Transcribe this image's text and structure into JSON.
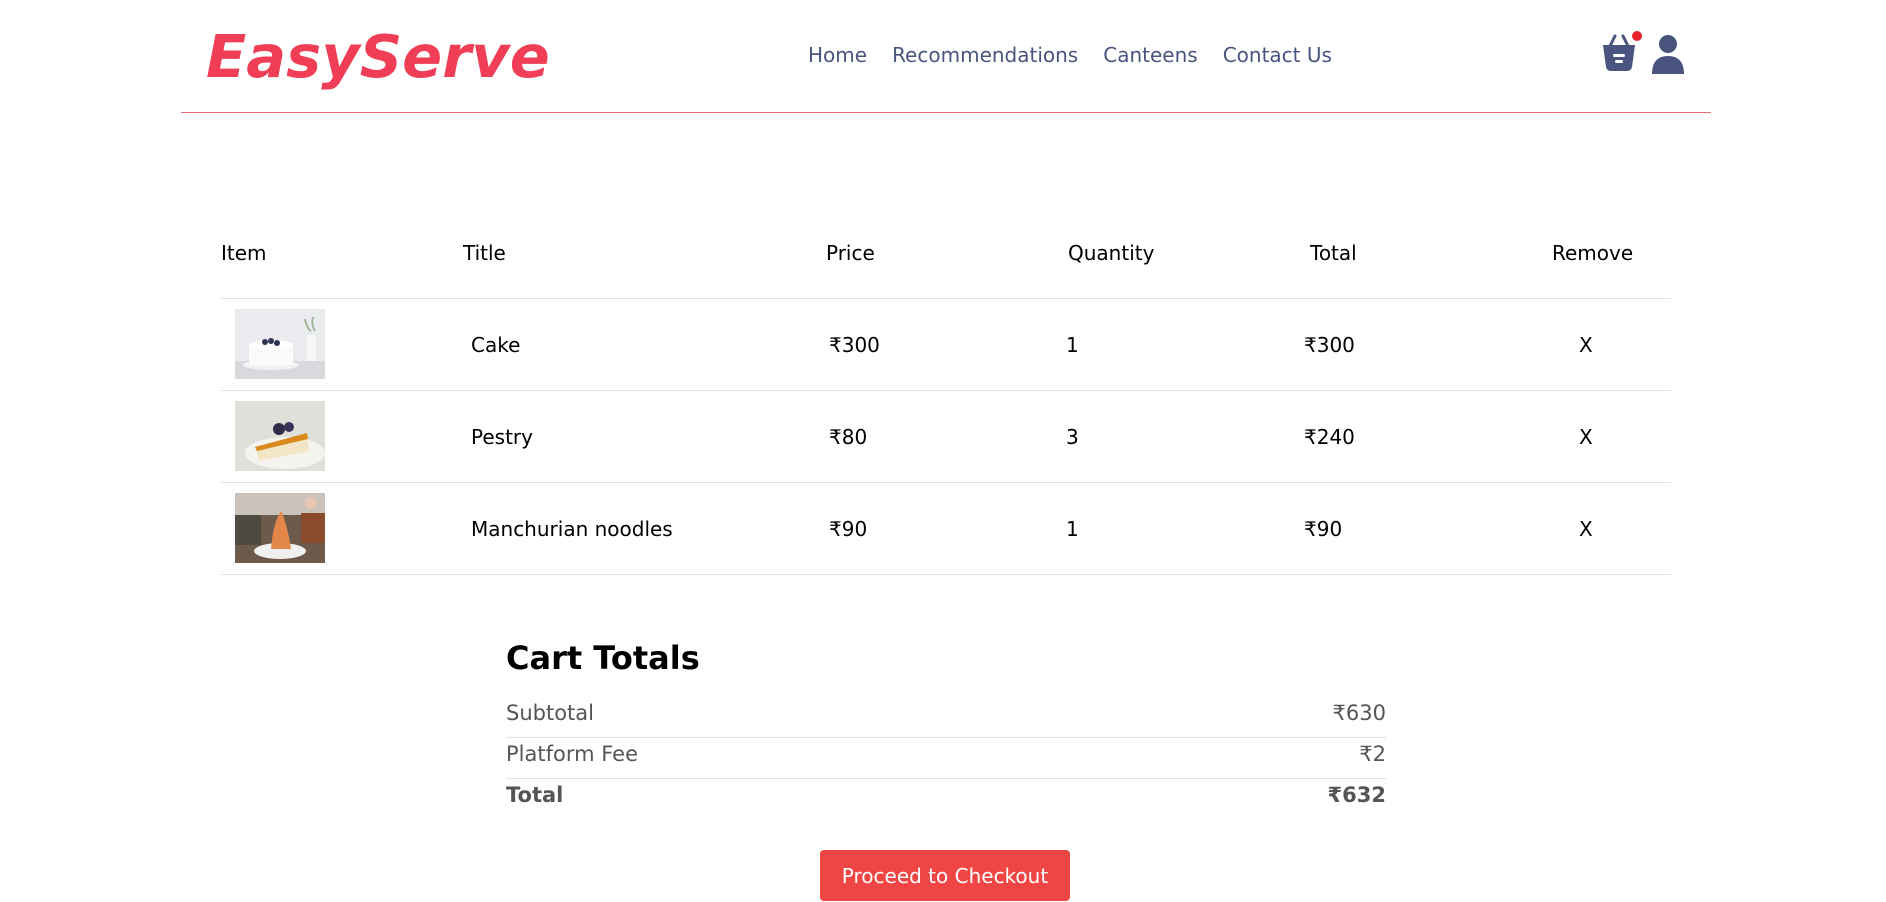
{
  "brand": {
    "logo": "EasyServe",
    "accent": "#ef3e55",
    "nav_color": "#49557e"
  },
  "nav": {
    "links": [
      "Home",
      "Recommendations",
      "Canteens",
      "Contact Us"
    ],
    "icons": {
      "cart": "basket-icon",
      "profile": "user-icon"
    },
    "cart_notification": true
  },
  "cart": {
    "headers": [
      "Item",
      "Title",
      "Price",
      "Quantity",
      "Total",
      "Remove"
    ],
    "items": [
      {
        "title": "Cake",
        "price": "₹300",
        "quantity": "1",
        "total": "₹300",
        "remove": "X",
        "image": "cake-photo"
      },
      {
        "title": "Pestry",
        "price": "₹80",
        "quantity": "3",
        "total": "₹240",
        "remove": "X",
        "image": "pastry-photo"
      },
      {
        "title": "Manchurian noodles",
        "price": "₹90",
        "quantity": "1",
        "total": "₹90",
        "remove": "X",
        "image": "noodles-photo"
      }
    ]
  },
  "totals": {
    "title": "Cart Totals",
    "subtotal_label": "Subtotal",
    "subtotal": "₹630",
    "fee_label": "Platform Fee",
    "fee": "₹2",
    "total_label": "Total",
    "total": "₹632"
  },
  "checkout": {
    "label": "Proceed to Checkout",
    "color": "#ef4545"
  }
}
